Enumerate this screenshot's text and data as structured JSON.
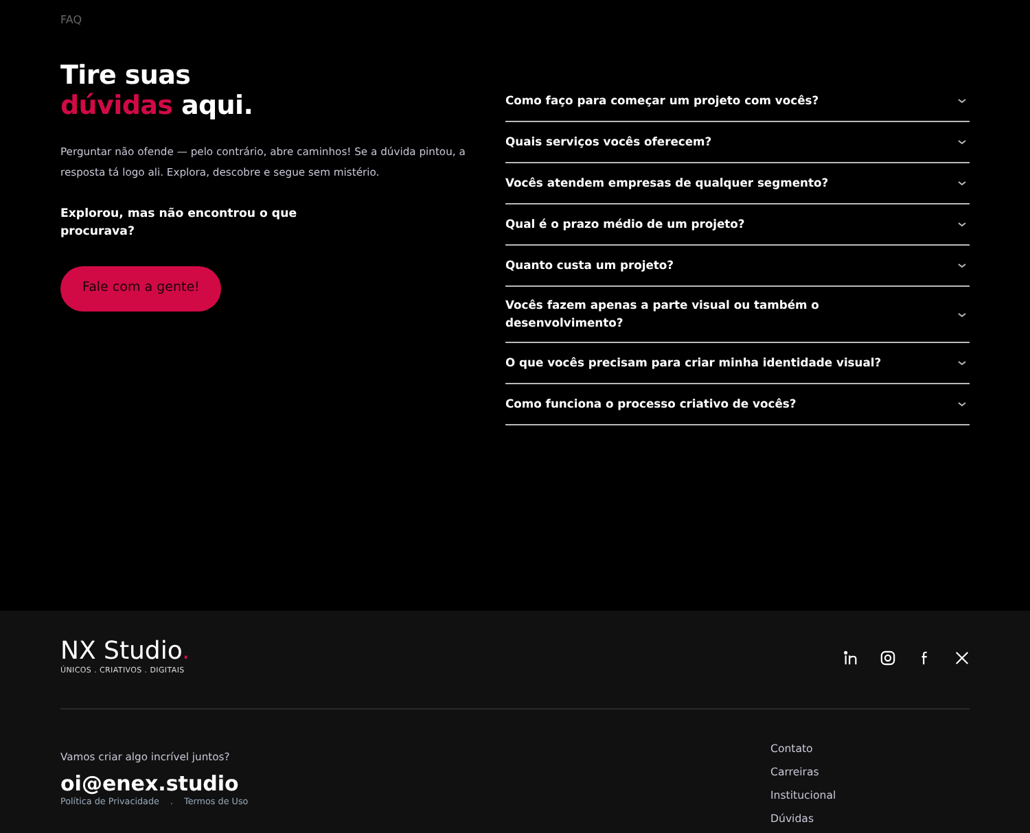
{
  "eyebrow": "FAQ",
  "heading": {
    "line_1": "Tire suas",
    "highlight": "dúvidas",
    "rest": "aqui."
  },
  "intro": "Perguntar não ofende — pelo contrário, abre caminhos! Se a dúvida pintou, a resposta tá logo ali. Explora, descobre e segue sem mistério.",
  "prompt": "Explorou, mas não encontrou o que procurava?",
  "cta_button": "Fale com a gente!",
  "faq": [
    {
      "question": "Como faço para começar um projeto com vocês?",
      "expanded": false
    },
    {
      "question": "Quais serviços vocês oferecem?",
      "expanded": false
    },
    {
      "question": "Vocês atendem empresas de qualquer segmento?",
      "expanded": false
    },
    {
      "question": "Qual é o prazo médio de um projeto?",
      "expanded": false
    },
    {
      "question": "Quanto custa um projeto?",
      "expanded": false
    },
    {
      "question": "Vocês fazem apenas a parte visual ou também o desenvolvimento?",
      "expanded": false
    },
    {
      "question": "O que vocês precisam para criar minha identidade visual?",
      "expanded": false
    },
    {
      "question": "Como funciona o processo criativo de vocês?",
      "expanded": false
    }
  ],
  "footer": {
    "logo": "NX Studio",
    "logo_dot": ".",
    "tagline": "ÚNICOS . CRIATIVOS . DIGITAIS",
    "invite": "Vamos criar algo incrível juntos?",
    "email": "oi@enex.studio",
    "legal_links": [
      {
        "label": "Política de Privacidade"
      },
      {
        "label": "Termos de Uso"
      }
    ],
    "legal_separator": ".",
    "nav_links": [
      {
        "label": "Contato"
      },
      {
        "label": "Carreiras"
      },
      {
        "label": "Institucional"
      },
      {
        "label": "Dúvidas"
      }
    ]
  }
}
